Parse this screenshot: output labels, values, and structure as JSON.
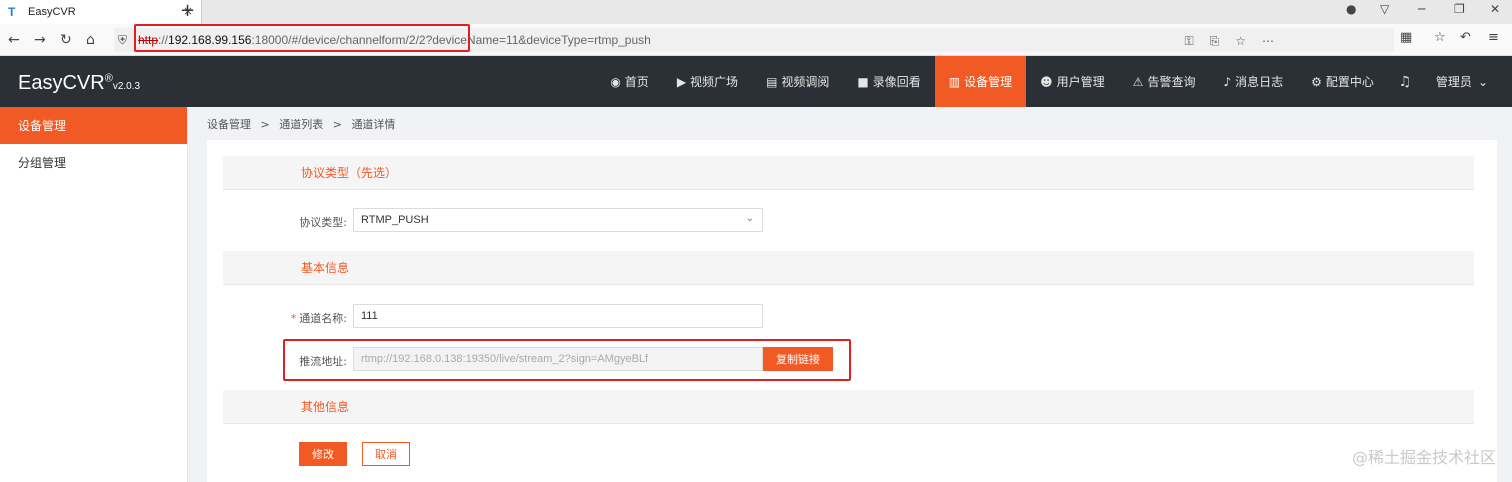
{
  "browser": {
    "tab_title": "EasyCVR",
    "tab_close": "×",
    "new_tab": "+",
    "url_protocol": "http",
    "url_sep": "://",
    "url_host": "192.168.99.156",
    "url_rest": ":18000/#/device/channelform/2/2?deviceName=11&deviceType=rtmp_push"
  },
  "app": {
    "logo": "EasyCVR",
    "logo_reg": "®",
    "version": "v2.0.3",
    "nav": [
      {
        "label": "首页",
        "icon": "dashboard-icon"
      },
      {
        "label": "视频广场",
        "icon": "play-icon"
      },
      {
        "label": "视频调阅",
        "icon": "grid-icon"
      },
      {
        "label": "录像回看",
        "icon": "camera-icon"
      },
      {
        "label": "设备管理",
        "icon": "device-icon",
        "active": true
      },
      {
        "label": "用户管理",
        "icon": "user-icon"
      },
      {
        "label": "告警查询",
        "icon": "alarm-icon"
      },
      {
        "label": "消息日志",
        "icon": "bell-icon"
      },
      {
        "label": "配置中心",
        "icon": "gear-icon"
      }
    ],
    "user": "管理员"
  },
  "sidebar": {
    "items": [
      {
        "label": "设备管理",
        "active": true
      },
      {
        "label": "分组管理"
      }
    ]
  },
  "breadcrumb": [
    "设备管理",
    ">",
    "通道列表",
    ">",
    "通道详情"
  ],
  "form": {
    "section_protocol": "协议类型（先选）",
    "protocol_label": "协议类型:",
    "protocol_value": "RTMP_PUSH",
    "section_basic": "基本信息",
    "name_label": "通道名称:",
    "name_value": "111",
    "push_label": "推流地址:",
    "push_value": "rtmp://192.168.0.138:19350/live/stream_2?sign=AMgyeBLf",
    "copy_button": "复制链接",
    "section_other": "其他信息",
    "submit_button": "修改",
    "cancel_button": "取消"
  },
  "watermark": "@稀土掘金技术社区",
  "colors": {
    "accent": "#f15a24",
    "header": "#2b2f36",
    "highlight": "#e02020"
  }
}
